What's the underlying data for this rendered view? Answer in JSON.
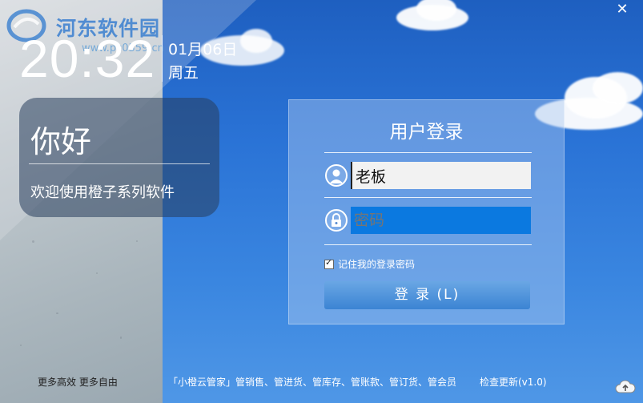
{
  "window": {
    "close_icon_char": "✕"
  },
  "watermark": {
    "title": "河东软件园",
    "url": "www.pc0359.cn"
  },
  "clock": {
    "time": "20:32",
    "date": "01月06日",
    "weekday": "周五"
  },
  "greeting": {
    "title": "你好",
    "subtitle": "欢迎使用橙子系列软件"
  },
  "login": {
    "title": "用户登录",
    "username_value": "老板",
    "password_placeholder": "密码",
    "remember_label": "记住我的登录密码",
    "remember_checked": true,
    "submit_label": "登 录 (L)"
  },
  "footer": {
    "slogan": "更多高效  更多自由",
    "products": "「小橙云管家」管销售、管进货、管库存、管账款、管订货、管会员",
    "update_label": "检查更新(v1.0)"
  },
  "colors": {
    "sky": "#2a73d6",
    "password_field": "#0b79e0",
    "button": "#3b84d3"
  }
}
